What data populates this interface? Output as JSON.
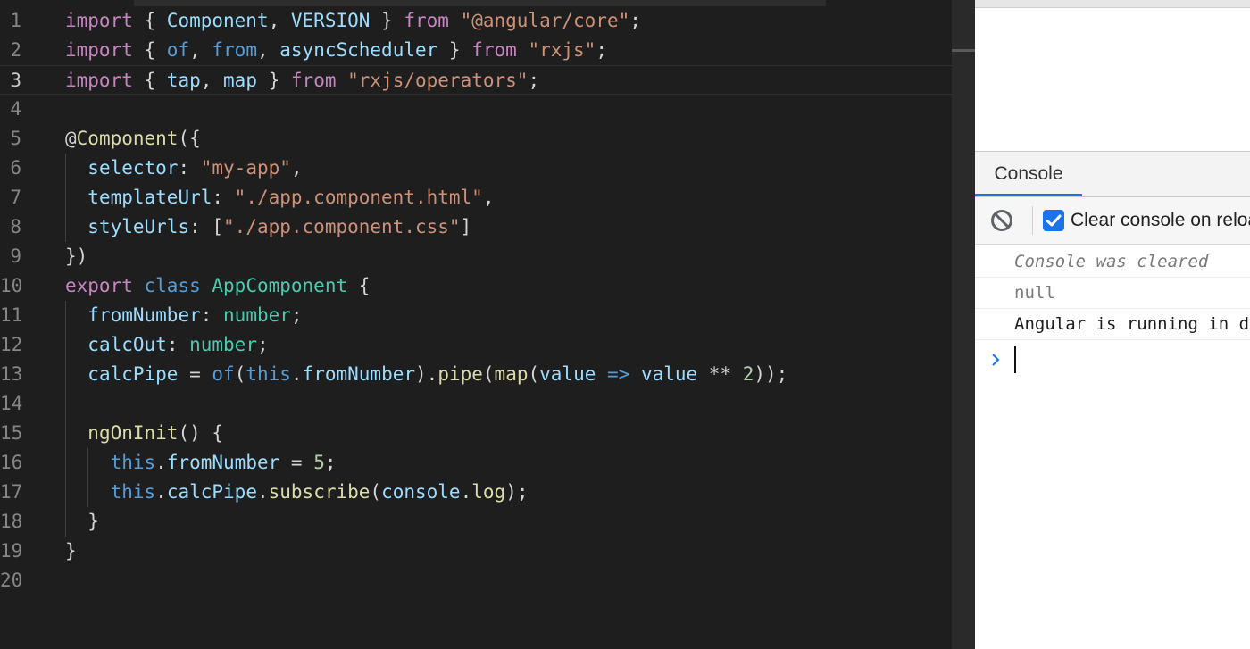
{
  "editor": {
    "line_numbers": [
      "1",
      "2",
      "3",
      "4",
      "5",
      "6",
      "7",
      "8",
      "9",
      "10",
      "11",
      "12",
      "13",
      "14",
      "15",
      "16",
      "17",
      "18",
      "19",
      "20"
    ],
    "current_line": "3",
    "lines": [
      [
        {
          "t": "import",
          "c": "kw"
        },
        {
          "t": " { ",
          "c": "pl"
        },
        {
          "t": "Component",
          "c": "var"
        },
        {
          "t": ", ",
          "c": "pl"
        },
        {
          "t": "VERSION",
          "c": "var"
        },
        {
          "t": " } ",
          "c": "pl"
        },
        {
          "t": "from",
          "c": "kw"
        },
        {
          "t": " ",
          "c": "pl"
        },
        {
          "t": "\"@angular/core\"",
          "c": "str"
        },
        {
          "t": ";",
          "c": "pl"
        }
      ],
      [
        {
          "t": "import",
          "c": "kw"
        },
        {
          "t": " { ",
          "c": "pl"
        },
        {
          "t": "of",
          "c": "blue"
        },
        {
          "t": ", ",
          "c": "pl"
        },
        {
          "t": "from",
          "c": "blue"
        },
        {
          "t": ", ",
          "c": "pl"
        },
        {
          "t": "asyncScheduler",
          "c": "var"
        },
        {
          "t": " } ",
          "c": "pl"
        },
        {
          "t": "from",
          "c": "kw"
        },
        {
          "t": " ",
          "c": "pl"
        },
        {
          "t": "\"rxjs\"",
          "c": "str"
        },
        {
          "t": ";",
          "c": "pl"
        }
      ],
      [
        {
          "t": "import",
          "c": "kw"
        },
        {
          "t": " { ",
          "c": "pl"
        },
        {
          "t": "tap",
          "c": "var"
        },
        {
          "t": ", ",
          "c": "pl"
        },
        {
          "t": "map",
          "c": "var"
        },
        {
          "t": " } ",
          "c": "pl"
        },
        {
          "t": "from",
          "c": "kw"
        },
        {
          "t": " ",
          "c": "pl"
        },
        {
          "t": "\"rxjs/operators\"",
          "c": "str"
        },
        {
          "t": ";",
          "c": "pl"
        }
      ],
      [],
      [
        {
          "t": "@",
          "c": "pl"
        },
        {
          "t": "Component",
          "c": "fn"
        },
        {
          "t": "({",
          "c": "pl"
        }
      ],
      [
        {
          "t": "  ",
          "c": "pl"
        },
        {
          "t": "selector",
          "c": "var"
        },
        {
          "t": ": ",
          "c": "pl"
        },
        {
          "t": "\"my-app\"",
          "c": "str"
        },
        {
          "t": ",",
          "c": "pl"
        }
      ],
      [
        {
          "t": "  ",
          "c": "pl"
        },
        {
          "t": "templateUrl",
          "c": "var"
        },
        {
          "t": ": ",
          "c": "pl"
        },
        {
          "t": "\"./app.component.html\"",
          "c": "str"
        },
        {
          "t": ",",
          "c": "pl"
        }
      ],
      [
        {
          "t": "  ",
          "c": "pl"
        },
        {
          "t": "styleUrls",
          "c": "var"
        },
        {
          "t": ": [",
          "c": "pl"
        },
        {
          "t": "\"./app.component.css\"",
          "c": "str"
        },
        {
          "t": "]",
          "c": "pl"
        }
      ],
      [
        {
          "t": "})",
          "c": "pl"
        }
      ],
      [
        {
          "t": "export",
          "c": "kw"
        },
        {
          "t": " ",
          "c": "pl"
        },
        {
          "t": "class",
          "c": "blue"
        },
        {
          "t": " ",
          "c": "pl"
        },
        {
          "t": "AppComponent",
          "c": "cls"
        },
        {
          "t": " {",
          "c": "pl"
        }
      ],
      [
        {
          "t": "  ",
          "c": "pl"
        },
        {
          "t": "fromNumber",
          "c": "var"
        },
        {
          "t": ": ",
          "c": "pl"
        },
        {
          "t": "number",
          "c": "cls"
        },
        {
          "t": ";",
          "c": "pl"
        }
      ],
      [
        {
          "t": "  ",
          "c": "pl"
        },
        {
          "t": "calcOut",
          "c": "var"
        },
        {
          "t": ": ",
          "c": "pl"
        },
        {
          "t": "number",
          "c": "cls"
        },
        {
          "t": ";",
          "c": "pl"
        }
      ],
      [
        {
          "t": "  ",
          "c": "pl"
        },
        {
          "t": "calcPipe",
          "c": "var"
        },
        {
          "t": " = ",
          "c": "pl"
        },
        {
          "t": "of",
          "c": "blue"
        },
        {
          "t": "(",
          "c": "pl"
        },
        {
          "t": "this",
          "c": "blue"
        },
        {
          "t": ".",
          "c": "pl"
        },
        {
          "t": "fromNumber",
          "c": "var"
        },
        {
          "t": ").",
          "c": "pl"
        },
        {
          "t": "pipe",
          "c": "fn"
        },
        {
          "t": "(",
          "c": "pl"
        },
        {
          "t": "map",
          "c": "fn"
        },
        {
          "t": "(",
          "c": "pl"
        },
        {
          "t": "value",
          "c": "var"
        },
        {
          "t": " => ",
          "c": "blue"
        },
        {
          "t": "value",
          "c": "var"
        },
        {
          "t": " ** ",
          "c": "pl"
        },
        {
          "t": "2",
          "c": "num"
        },
        {
          "t": "));",
          "c": "pl"
        }
      ],
      [],
      [
        {
          "t": "  ",
          "c": "pl"
        },
        {
          "t": "ngOnInit",
          "c": "fn"
        },
        {
          "t": "() {",
          "c": "pl"
        }
      ],
      [
        {
          "t": "    ",
          "c": "pl"
        },
        {
          "t": "this",
          "c": "blue"
        },
        {
          "t": ".",
          "c": "pl"
        },
        {
          "t": "fromNumber",
          "c": "var"
        },
        {
          "t": " = ",
          "c": "pl"
        },
        {
          "t": "5",
          "c": "num"
        },
        {
          "t": ";",
          "c": "pl"
        }
      ],
      [
        {
          "t": "    ",
          "c": "pl"
        },
        {
          "t": "this",
          "c": "blue"
        },
        {
          "t": ".",
          "c": "pl"
        },
        {
          "t": "calcPipe",
          "c": "var"
        },
        {
          "t": ".",
          "c": "pl"
        },
        {
          "t": "subscribe",
          "c": "fn"
        },
        {
          "t": "(",
          "c": "pl"
        },
        {
          "t": "console",
          "c": "var"
        },
        {
          "t": ".",
          "c": "pl"
        },
        {
          "t": "log",
          "c": "fn"
        },
        {
          "t": ");",
          "c": "pl"
        }
      ],
      [
        {
          "t": "  }",
          "c": "pl"
        }
      ],
      [
        {
          "t": "}",
          "c": "pl"
        }
      ],
      []
    ]
  },
  "devtools": {
    "tab_label": "Console",
    "clear_icon": "block-icon",
    "checkbox_checked": true,
    "checkbox_label": "Clear console on reload",
    "messages": {
      "cleared": "Console was cleared",
      "null": "null",
      "angular": "Angular is running in development mode. Call enableProdMode() to enable production mode."
    },
    "prompt_icon": "chevron-right-icon",
    "accent": "#1a73e8"
  }
}
